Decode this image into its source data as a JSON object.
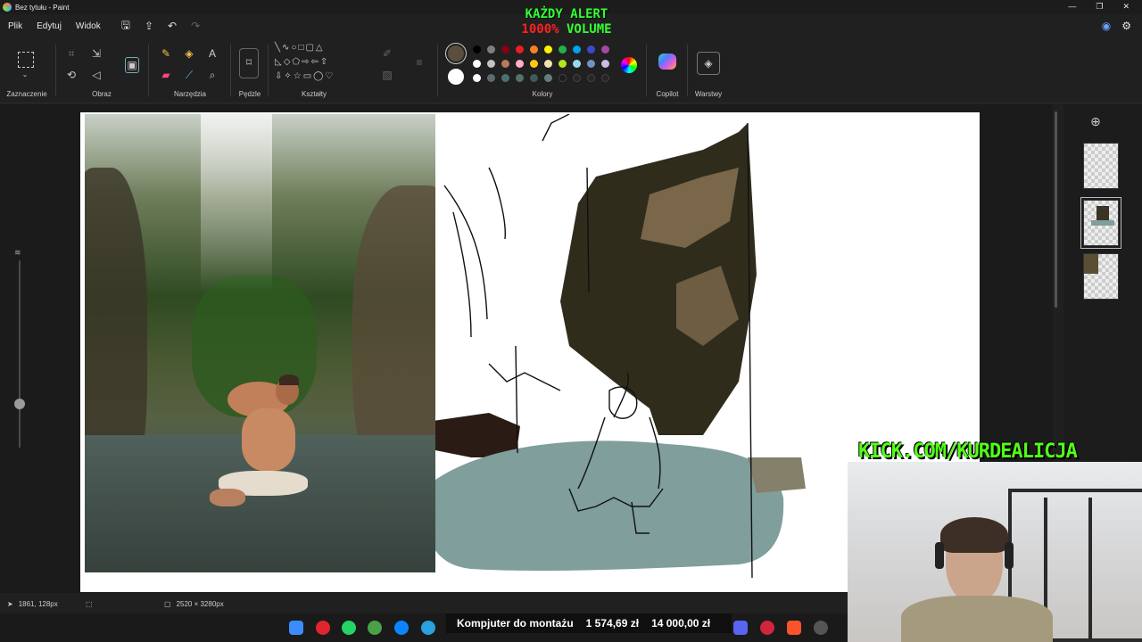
{
  "window": {
    "title": "Bez tytułu - Paint",
    "minimize": "—",
    "maximize": "❐",
    "close": "✕"
  },
  "menu": {
    "items": [
      "Plik",
      "Edytuj",
      "Widok"
    ]
  },
  "overlay_alert": {
    "line1": "KAŻDY ALERT",
    "line2_value": "1000%",
    "line2_word": "VOLUME"
  },
  "ribbon": {
    "groups": [
      "Zaznaczenie",
      "Obraz",
      "Narzędzia",
      "Pędzle",
      "Kształty",
      "Kolory",
      "Copilot",
      "Warstwy"
    ],
    "current_color": "#5a4f3c",
    "secondary_color": "#ffffff",
    "palette_row1": [
      "#000000",
      "#7f7f7f",
      "#880015",
      "#ed1c24",
      "#ff7f27",
      "#fff200",
      "#22b14c",
      "#00a2e8",
      "#3f48cc",
      "#a349a4"
    ],
    "palette_row2": [
      "#ffffff",
      "#c3c3c3",
      "#b97a57",
      "#ffaec9",
      "#ffc90e",
      "#efe4b0",
      "#b5e61d",
      "#99d9ea",
      "#7092be",
      "#c8bfe7"
    ],
    "palette_row3": [
      "#ffffff",
      "#5b6b70",
      "#4d6f6f",
      "#54716c",
      "#3f5a59",
      "#607e7c",
      "#1c1c1c",
      "#262626",
      "#262626",
      "#262626"
    ]
  },
  "layers_panel": {
    "add_icon": "⊕"
  },
  "status": {
    "cursor": "1861, 128px",
    "canvas_size": "2520 × 3280px"
  },
  "ticker": {
    "label": "Kompjuter do montażu",
    "value1": "1 574,69 zł",
    "value2": "14 000,00 zł"
  },
  "kick": {
    "text": "KICK.COM/KURDEALICJA"
  }
}
